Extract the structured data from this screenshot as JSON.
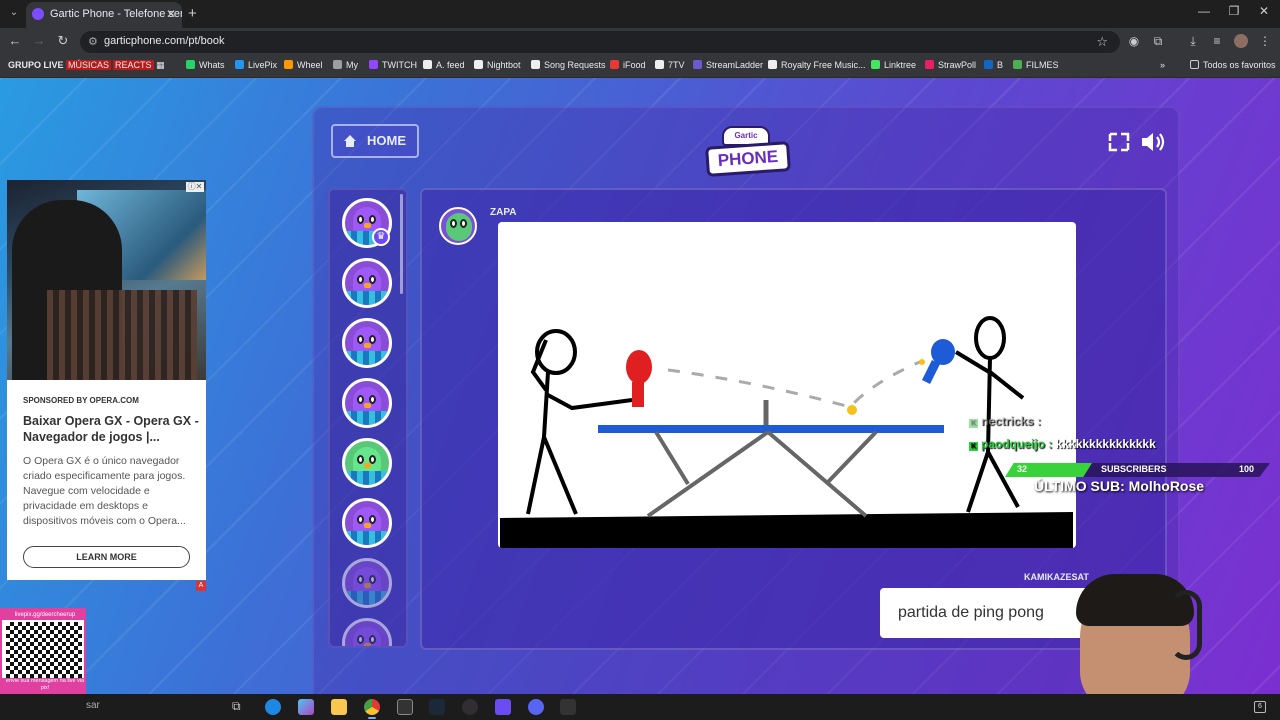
{
  "browser": {
    "tab_title": "Gartic Phone - Telefone sem fio",
    "url": "garticphone.com/pt/book",
    "bookmarks": [
      {
        "label": "GRUPO LIVE",
        "color": ""
      },
      {
        "label": "MÚSICAS",
        "color": "#e53935"
      },
      {
        "label": "REACTS",
        "color": "#e53935"
      },
      {
        "label": "Whats",
        "color": "#25d366"
      },
      {
        "label": "LivePix",
        "color": "#2196f3"
      },
      {
        "label": "Wheel",
        "color": "#ff9800"
      },
      {
        "label": "My",
        "color": "#9e9e9e"
      },
      {
        "label": "TWITCH",
        "color": "#9146ff"
      },
      {
        "label": "A. feed",
        "color": "#eeeeee"
      },
      {
        "label": "Nightbot",
        "color": "#eeeeee"
      },
      {
        "label": "Song Requests",
        "color": "#eeeeee"
      },
      {
        "label": "iFood",
        "color": "#e53935"
      },
      {
        "label": "7TV",
        "color": "#eeeeee"
      },
      {
        "label": "StreamLadder",
        "color": "#6a5acd"
      },
      {
        "label": "Royalty Free Music...",
        "color": "#eeeeee"
      },
      {
        "label": "Linktree",
        "color": "#43e660"
      },
      {
        "label": "StrawPoll",
        "color": "#e91e63"
      },
      {
        "label": "B",
        "color": "#1565c0"
      },
      {
        "label": "FILMES",
        "color": "#4caf50"
      }
    ],
    "all_favorites": "Todos os favoritos"
  },
  "ad": {
    "sponsor": "SPONSORED BY OPERA.COM",
    "title": "Baixar Opera GX - Opera GX - Navegador de jogos |...",
    "description": "O Opera GX é o único navegador criado especificamente para jogos. Navegue com velocidade e privacidade em desktops e dispositivos móveis com o Opera...",
    "cta": "LEARN MORE",
    "badge": "A"
  },
  "qr": {
    "header": "livepix.gg/deercheerup",
    "footer": "envie sua mensagem na live via pix!"
  },
  "game": {
    "home_label": "HOME",
    "logo_top": "Gartic",
    "logo_word": "PHONE",
    "author": "ZAPA",
    "guess_author": "KAMIKAZESAT",
    "guess_text": "partida de ping pong",
    "player_colors": [
      "#8a4dd8",
      "#8a4dd8",
      "#8a4dd8",
      "#8a4dd8",
      "#59c878",
      "#8a4dd8",
      "#8a4dd8",
      "#8a4dd8"
    ]
  },
  "overlay": {
    "chat": [
      {
        "user": "nectricks",
        "message": ""
      },
      {
        "user": "paodqueijo",
        "message": "kkkkkkkkkkkkkkk"
      }
    ],
    "subs_label": "SUBSCRIBERS",
    "subs_current": 32,
    "subs_goal": 100,
    "last_sub": "ÚLTIMO SUB: MolhoRose"
  },
  "taskbar": {
    "search_text": "sar",
    "notifications": "6"
  }
}
